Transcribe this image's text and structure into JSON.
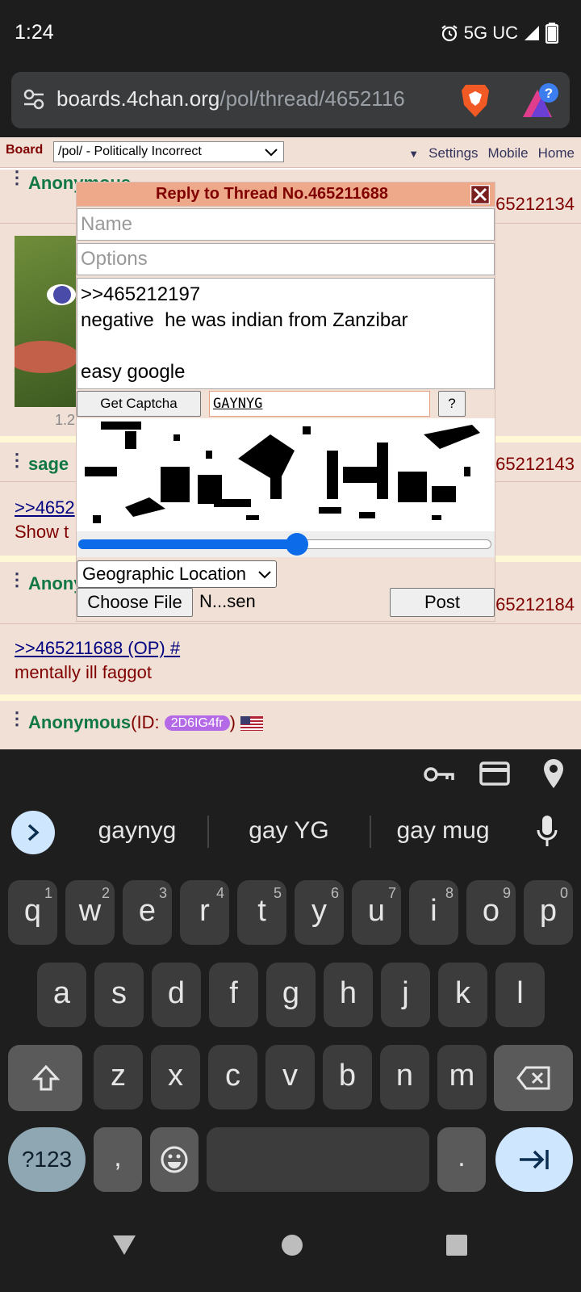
{
  "status_bar": {
    "time": "1:24",
    "network": "5G UC"
  },
  "browser": {
    "url_host": "boards.4chan.org",
    "url_path": "/pol/thread/4652116"
  },
  "topnav": {
    "board_label": "Board",
    "board_selected": "/pol/ - Politically Incorrect",
    "links": [
      "Settings",
      "Mobile",
      "Home"
    ]
  },
  "posts": [
    {
      "name": "Anonymous",
      "num": "465212134",
      "image_size": "1.2"
    },
    {
      "name": "sage",
      "num": "465212143",
      "quote": ">>4652",
      "text": "Show t"
    },
    {
      "name": "Anonymous",
      "num": "465212184",
      "quote": ">>465211688 (OP) #",
      "text": "mentally ill faggot"
    },
    {
      "name": "Anonymous",
      "id_label": "(ID: ",
      "id": "2D6IG4fr",
      "id_close": ")"
    }
  ],
  "reply_form": {
    "title": "Reply to Thread No.465211688",
    "name_placeholder": "Name",
    "options_placeholder": "Options",
    "comment": ">>465212197\nnegative  he was indian from Zanzibar\n\neasy google",
    "get_captcha": "Get Captcha",
    "captcha_value": "GAYNYG",
    "help_button": "?",
    "captcha_slider_fraction": 0.53,
    "geo_select": "Geographic Location",
    "choose_file": "Choose File",
    "file_name": "N...sen",
    "post_button": "Post"
  },
  "autofill_bar": {
    "icons": [
      "key-icon",
      "card-icon",
      "location-icon"
    ]
  },
  "keyboard": {
    "suggestions": [
      "gaynyg",
      "gay YG",
      "gay mug"
    ],
    "row1": [
      "q",
      "w",
      "e",
      "r",
      "t",
      "y",
      "u",
      "i",
      "o",
      "p"
    ],
    "row1_hints": [
      "1",
      "2",
      "3",
      "4",
      "5",
      "6",
      "7",
      "8",
      "9",
      "0"
    ],
    "row2": [
      "a",
      "s",
      "d",
      "f",
      "g",
      "h",
      "j",
      "k",
      "l"
    ],
    "row3": [
      "z",
      "x",
      "c",
      "v",
      "b",
      "n",
      "m"
    ],
    "sym_key": "?123",
    "comma": ",",
    "period": "."
  },
  "colors": {
    "page_bg": "#f0e0d6",
    "name_green": "#117743",
    "maroon": "#800000",
    "keyboard_bg": "#1e1e1e",
    "key_bg": "#3c3c3c"
  }
}
